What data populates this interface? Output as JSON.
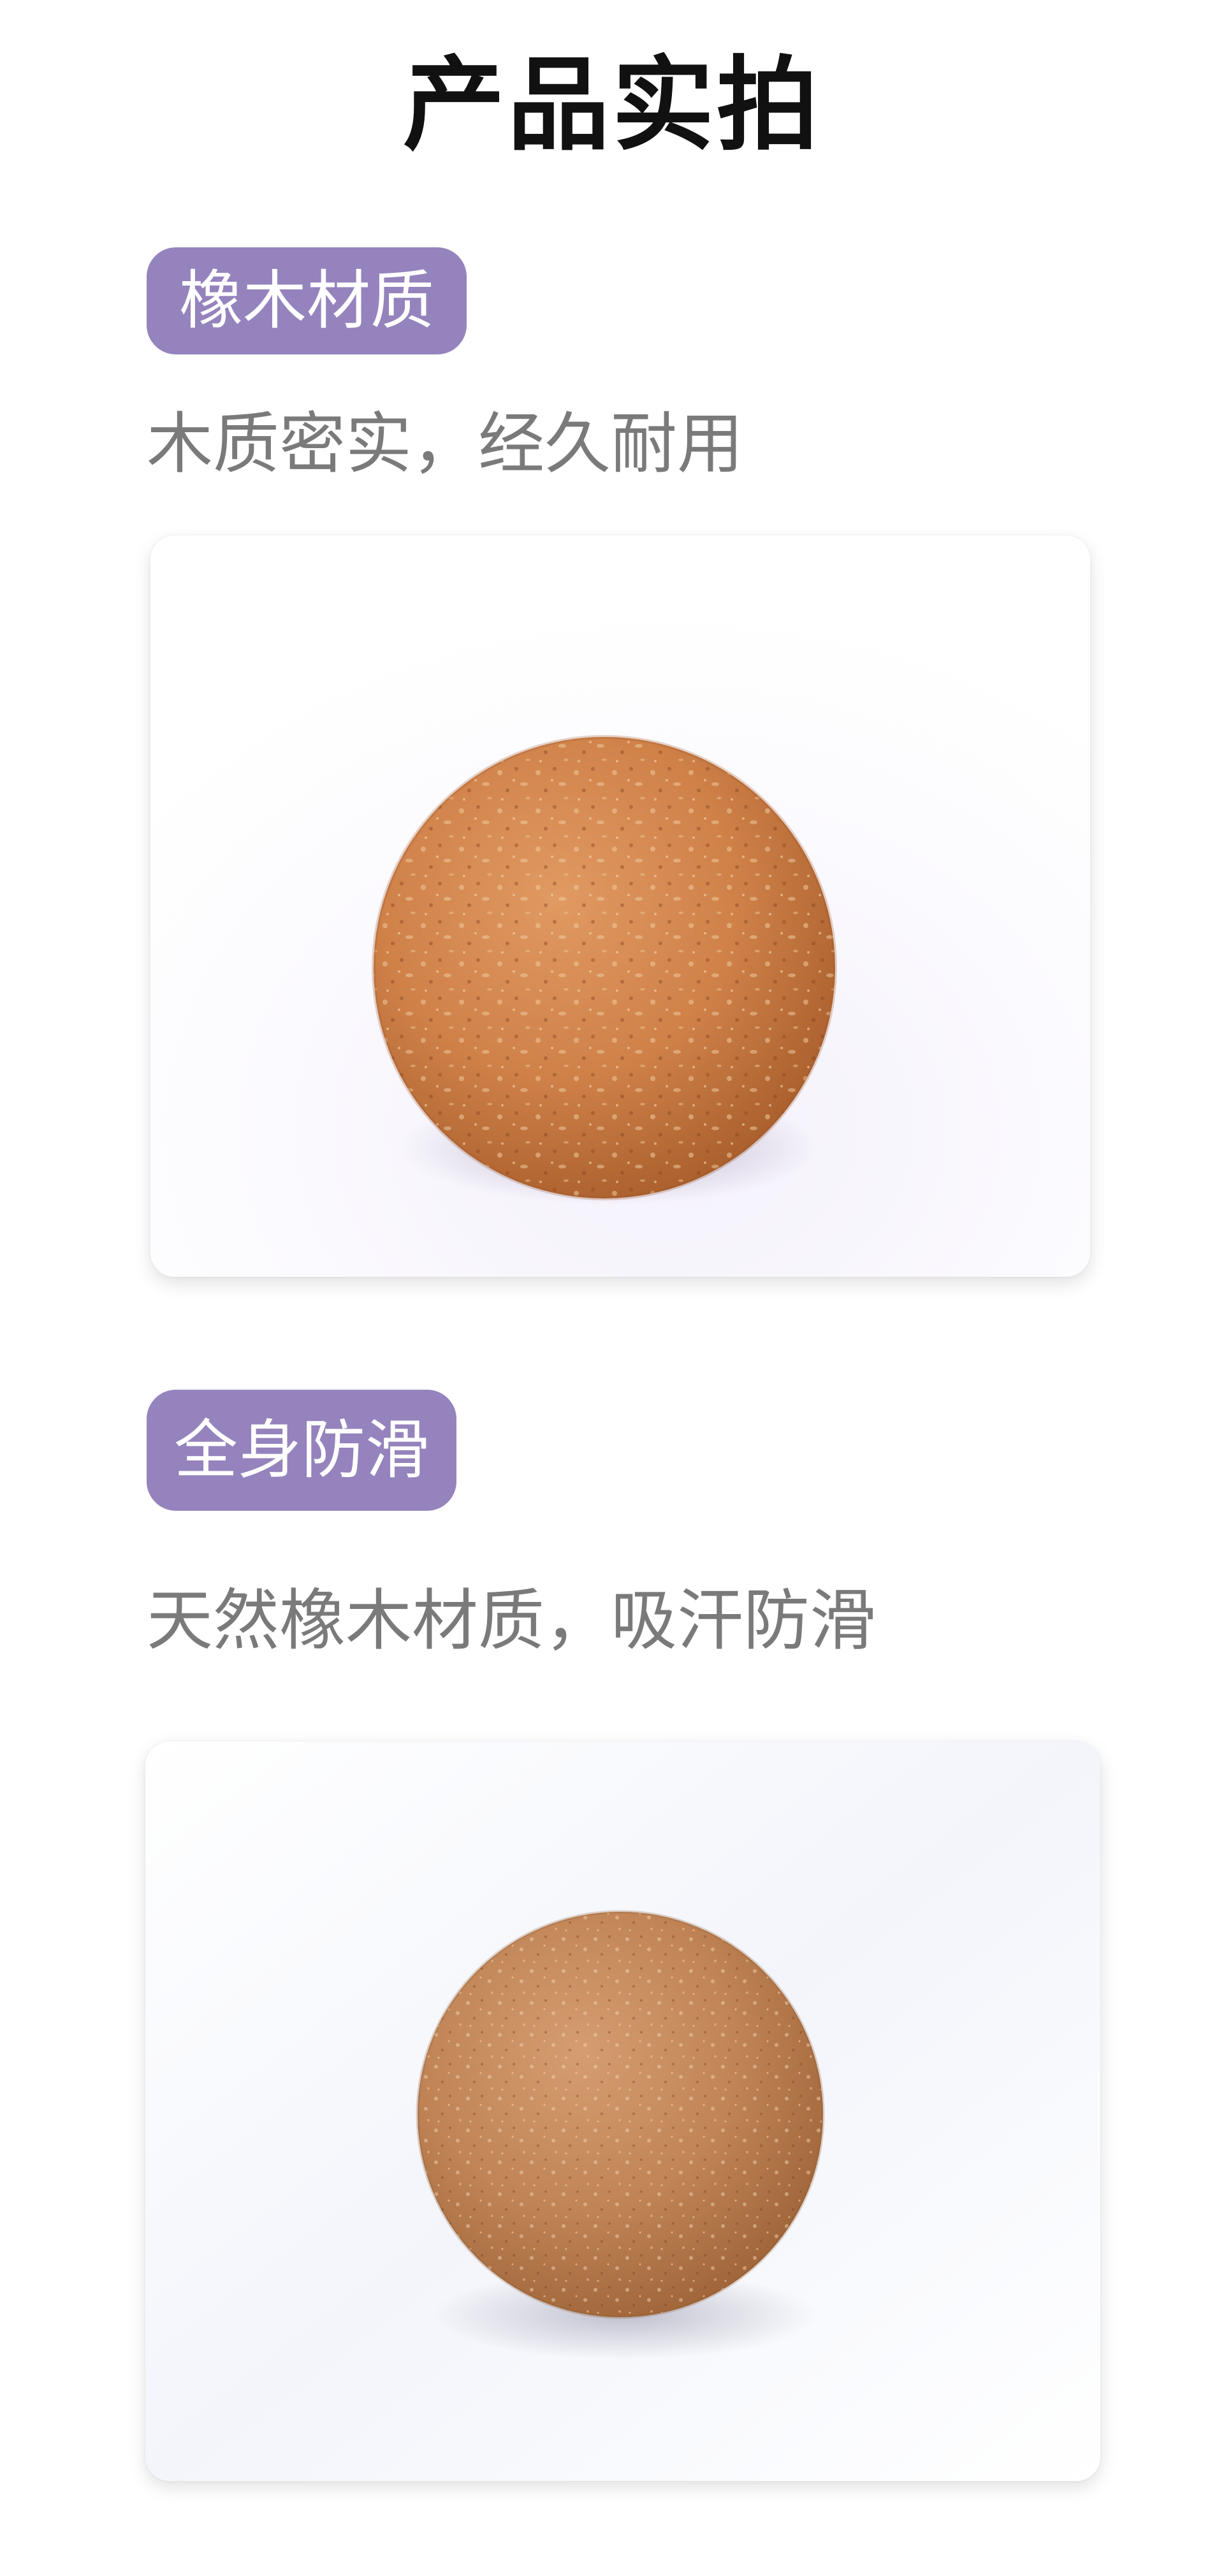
{
  "page": {
    "title": "产品实拍"
  },
  "sections": [
    {
      "tag": "橡木材质",
      "description": "木质密实，经久耐用",
      "image": "cork-ball-photo"
    },
    {
      "tag": "全身防滑",
      "description": "天然橡木材质，吸汗防滑",
      "image": "cork-ball-photo"
    }
  ],
  "colors": {
    "tag_background": "#9583bd",
    "tag_text": "#ffffff",
    "description_text": "#7a7a7a",
    "title_text": "#111111",
    "cork_base": "#c97a44",
    "cork_base_2": "#c08456"
  }
}
